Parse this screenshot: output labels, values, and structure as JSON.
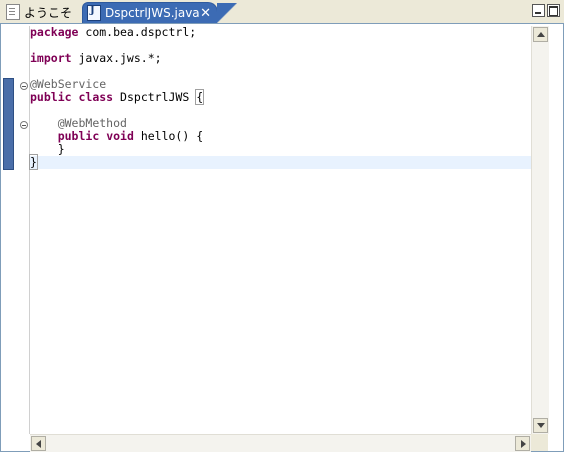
{
  "tabs": [
    {
      "label": "ようこそ",
      "icon": "document-icon"
    },
    {
      "label": "DspctrlJWS.java",
      "icon": "java-file-icon",
      "close": "✕"
    }
  ],
  "editor": {
    "code": {
      "l1_kw": "package",
      "l1_rest": " com.bea.dspctrl;",
      "l3_kw": "import",
      "l3_rest": " javax.jws.*;",
      "l5_anno": "@WebService",
      "l6_kw1": "public",
      "l6_kw2": "class",
      "l6_name": "DspctrlJWS",
      "l6_brace": "{",
      "l8_anno": "@WebMethod",
      "l9_kw1": "public",
      "l9_kw2": "void",
      "l9_rest": " hello() {",
      "l10": "    }",
      "l11": "}"
    }
  }
}
